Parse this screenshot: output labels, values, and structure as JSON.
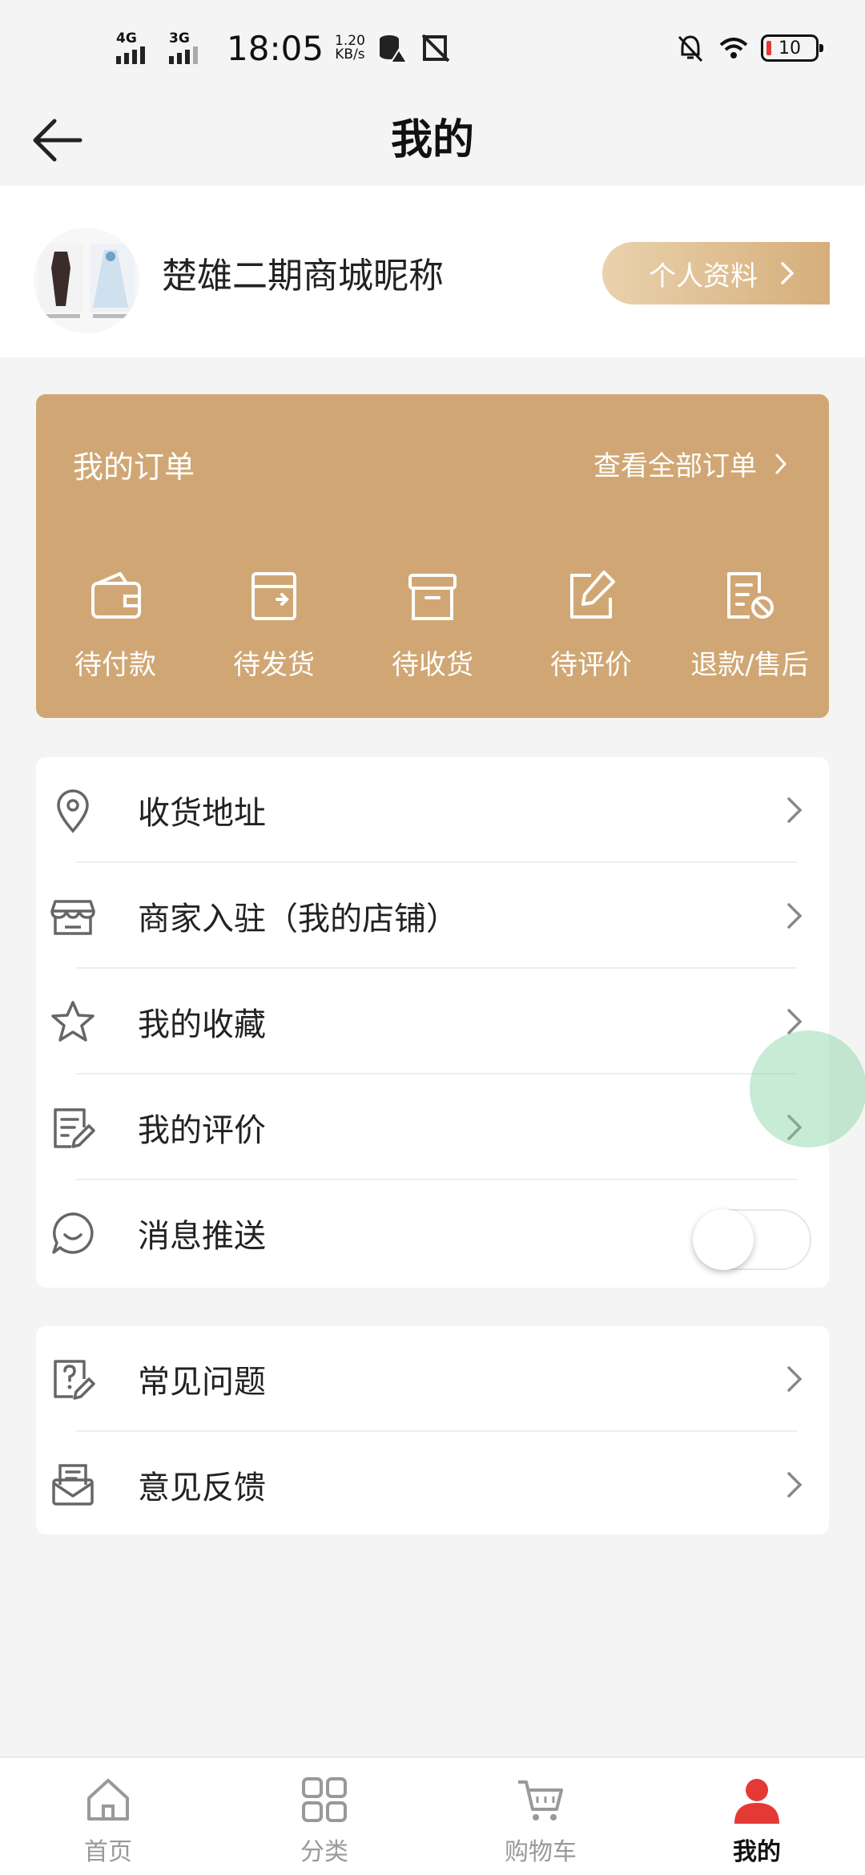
{
  "status_bar": {
    "net1": "4G",
    "net2": "3G",
    "time": "18:05",
    "speed_value": "1.20",
    "speed_unit": "KB/s",
    "battery": "10"
  },
  "header": {
    "title": "我的"
  },
  "profile": {
    "nickname": "楚雄二期商城昵称",
    "button_label": "个人资料"
  },
  "orders": {
    "title": "我的订单",
    "view_all": "查看全部订单",
    "items": [
      {
        "label": "待付款",
        "icon": "wallet-icon"
      },
      {
        "label": "待发货",
        "icon": "box-out-icon"
      },
      {
        "label": "待收货",
        "icon": "archive-icon"
      },
      {
        "label": "待评价",
        "icon": "edit-icon"
      },
      {
        "label": "退款/售后",
        "icon": "refund-icon"
      }
    ]
  },
  "menu1": [
    {
      "label": "收货地址",
      "icon": "location-icon"
    },
    {
      "label": "商家入驻（我的店铺）",
      "icon": "store-icon"
    },
    {
      "label": "我的收藏",
      "icon": "star-icon"
    },
    {
      "label": "我的评价",
      "icon": "review-icon"
    },
    {
      "label": "消息推送",
      "icon": "chat-icon",
      "toggle": false
    }
  ],
  "menu2": [
    {
      "label": "常见问题",
      "icon": "question-icon"
    },
    {
      "label": "意见反馈",
      "icon": "feedback-icon"
    }
  ],
  "tabbar": [
    {
      "label": "首页",
      "icon": "home-icon"
    },
    {
      "label": "分类",
      "icon": "grid-icon"
    },
    {
      "label": "购物车",
      "icon": "cart-icon"
    },
    {
      "label": "我的",
      "icon": "user-icon",
      "active": true
    }
  ],
  "colors": {
    "accent": "#d0a774",
    "active_tab": "#e53935"
  }
}
